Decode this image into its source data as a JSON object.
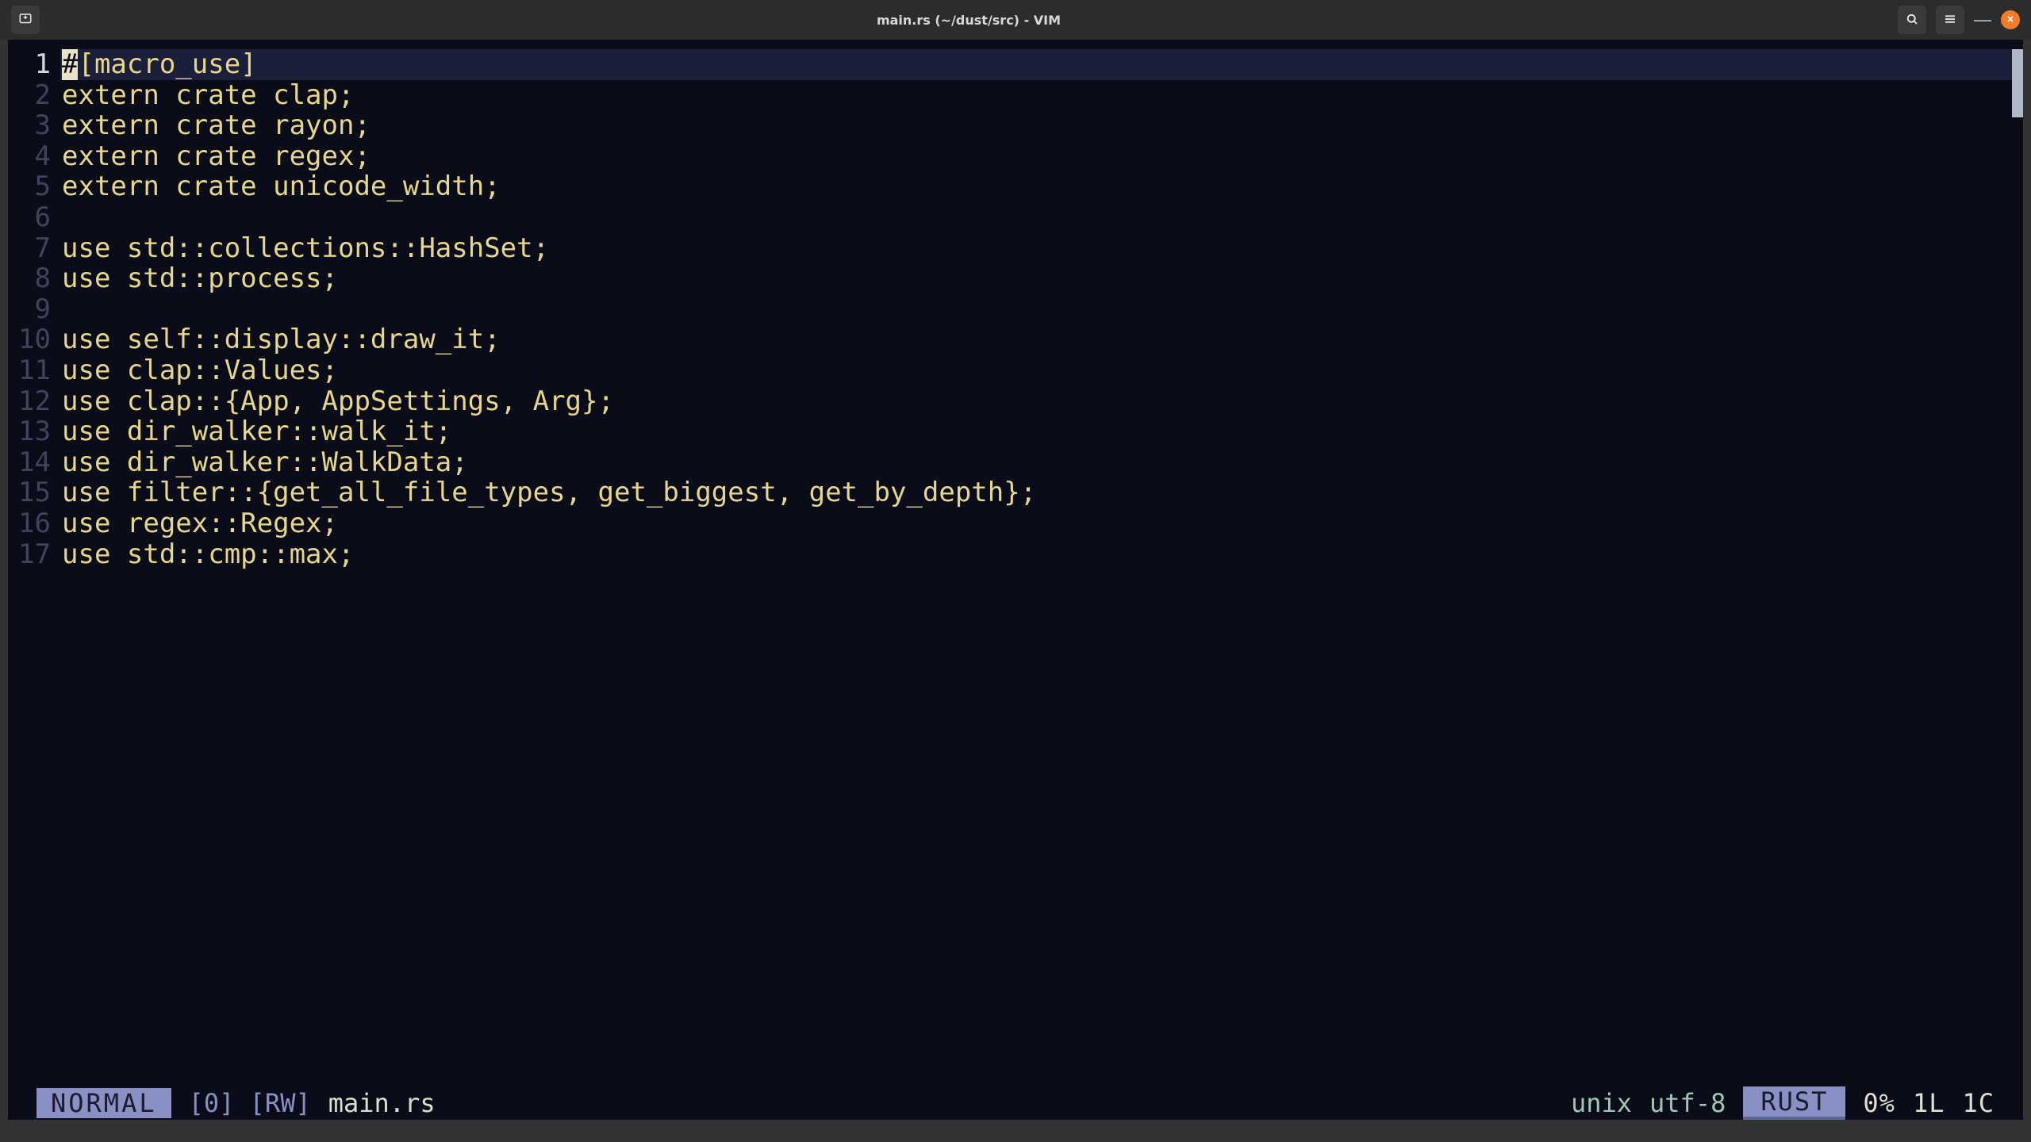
{
  "window": {
    "title": "main.rs (~/dust/src) - VIM"
  },
  "editor": {
    "cursor_char": "#",
    "lines": [
      {
        "n": 1,
        "text_after_cursor": "[macro_use]"
      },
      {
        "n": 2,
        "text": "extern crate clap;"
      },
      {
        "n": 3,
        "text": "extern crate rayon;"
      },
      {
        "n": 4,
        "text": "extern crate regex;"
      },
      {
        "n": 5,
        "text": "extern crate unicode_width;"
      },
      {
        "n": 6,
        "text": ""
      },
      {
        "n": 7,
        "text": "use std::collections::HashSet;"
      },
      {
        "n": 8,
        "text": "use std::process;"
      },
      {
        "n": 9,
        "text": ""
      },
      {
        "n": 10,
        "text": "use self::display::draw_it;"
      },
      {
        "n": 11,
        "text": "use clap::Values;"
      },
      {
        "n": 12,
        "text": "use clap::{App, AppSettings, Arg};"
      },
      {
        "n": 13,
        "text": "use dir_walker::walk_it;"
      },
      {
        "n": 14,
        "text": "use dir_walker::WalkData;"
      },
      {
        "n": 15,
        "text": "use filter::{get_all_file_types, get_biggest, get_by_depth};"
      },
      {
        "n": 16,
        "text": "use regex::Regex;"
      },
      {
        "n": 17,
        "text": "use std::cmp::max;"
      }
    ]
  },
  "status": {
    "mode": "NORMAL",
    "flags": "[0] [RW]",
    "filename": "main.rs",
    "fileformat": "unix",
    "encoding": "utf-8",
    "language": "RUST",
    "percent": "0%",
    "line": "1L",
    "col": "1C"
  }
}
